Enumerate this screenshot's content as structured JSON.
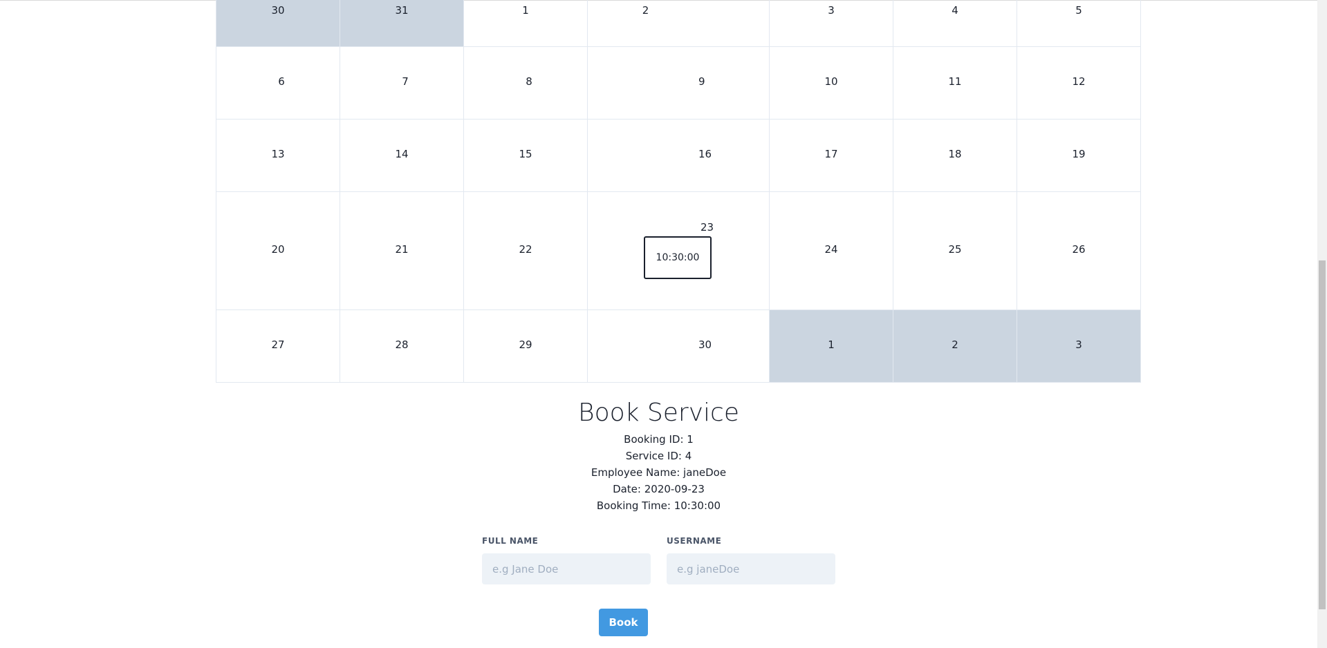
{
  "calendar": {
    "weeks": [
      [
        {
          "day": "30",
          "other_month": true
        },
        {
          "day": "31",
          "other_month": true
        },
        {
          "day": "1",
          "other_month": false
        },
        {
          "day": "2",
          "other_month": false
        },
        {
          "day": "3",
          "other_month": false
        },
        {
          "day": "4",
          "other_month": false
        },
        {
          "day": "5",
          "other_month": false
        }
      ],
      [
        {
          "day": "6",
          "other_month": false
        },
        {
          "day": "7",
          "other_month": false
        },
        {
          "day": "8",
          "other_month": false
        },
        {
          "day": "9",
          "other_month": false
        },
        {
          "day": "10",
          "other_month": false
        },
        {
          "day": "11",
          "other_month": false
        },
        {
          "day": "12",
          "other_month": false
        }
      ],
      [
        {
          "day": "13",
          "other_month": false
        },
        {
          "day": "14",
          "other_month": false
        },
        {
          "day": "15",
          "other_month": false
        },
        {
          "day": "16",
          "other_month": false
        },
        {
          "day": "17",
          "other_month": false
        },
        {
          "day": "18",
          "other_month": false
        },
        {
          "day": "19",
          "other_month": false
        }
      ],
      [
        {
          "day": "20",
          "other_month": false
        },
        {
          "day": "21",
          "other_month": false
        },
        {
          "day": "22",
          "other_month": false
        },
        {
          "day": "23",
          "other_month": false,
          "slot": "10:30:00"
        },
        {
          "day": "24",
          "other_month": false
        },
        {
          "day": "25",
          "other_month": false
        },
        {
          "day": "26",
          "other_month": false
        }
      ],
      [
        {
          "day": "27",
          "other_month": false
        },
        {
          "day": "28",
          "other_month": false
        },
        {
          "day": "29",
          "other_month": false
        },
        {
          "day": "30",
          "other_month": false
        },
        {
          "day": "1",
          "other_month": true
        },
        {
          "day": "2",
          "other_month": true
        },
        {
          "day": "3",
          "other_month": true
        }
      ]
    ]
  },
  "booking": {
    "title": "Book Service",
    "booking_id": "Booking ID: 1",
    "service_id": "Service ID: 4",
    "employee_name": "Employee Name: janeDoe",
    "date": "Date: 2020-09-23",
    "booking_time": "Booking Time: 10:30:00"
  },
  "form": {
    "full_name_label": "FULL NAME",
    "full_name_placeholder": "e.g Jane Doe",
    "full_name_value": "",
    "username_label": "USERNAME",
    "username_placeholder": "e.g janeDoe",
    "username_value": "",
    "book_label": "Book"
  },
  "colors": {
    "other_month_bg": "#cbd5e0",
    "button_bg": "#4299e1",
    "input_bg": "#edf2f7"
  }
}
